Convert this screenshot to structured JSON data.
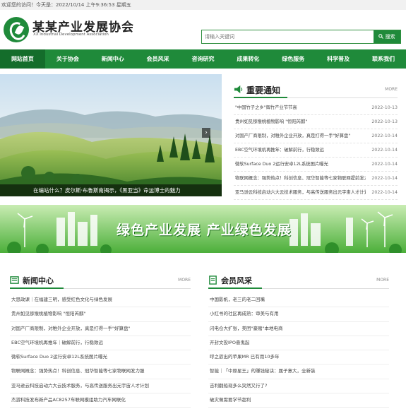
{
  "topbar": {
    "welcome": "欢迎您的访问！今天是：2022/10/14 上午9:36:53 星期五"
  },
  "header": {
    "title": "某某产业发展协会",
    "subtitle": "XX Industrial Development Association"
  },
  "search": {
    "placeholder": "请输入关键词",
    "button": "搜索",
    "button_icon": "search-icon"
  },
  "nav": [
    "网站首页",
    "关于协会",
    "新闻中心",
    "会员风采",
    "咨询研究",
    "成果转化",
    "绿色服务",
    "科学普及",
    "联系我们"
  ],
  "slider": {
    "caption": "在编站什么？皮尔斯·布鲁斯南揭示，《黑亚当》命运博士的魅力"
  },
  "notice": {
    "title": "重要通知",
    "more": "MORE",
    "items": [
      {
        "t": "\"中国竹子之乡\"辉竹产业节节高",
        "d": "2022-10-13"
      },
      {
        "t": "贵州如见猕猴桃植物影响 \"恒阳芮麒\"",
        "d": "2022-10-13"
      },
      {
        "t": "对国产厂商限制，对稚外企业开放，真是打得一手\"好算盘\"",
        "d": "2022-10-14"
      },
      {
        "t": "EBC空气环境机再推年：破解前行，行稳致远",
        "d": "2022-10-14"
      },
      {
        "t": "微软Surface Duo 2运行安卓12L系统图片曝光",
        "d": "2022-10-14"
      },
      {
        "t": "物联网概念：强势热点！科创信息、冠华智能等七家物联网提前发力",
        "d": "2022-10-14"
      },
      {
        "t": "亚马逊云科技启动六大云技术服务，与高传送服务出元宇宙人才计划",
        "d": "2022-10-14"
      }
    ]
  },
  "banner": {
    "text": "绿色产业发展 产业绿色发展"
  },
  "news": {
    "title": "新闻中心",
    "more": "MORE",
    "items": [
      "大思政课｜在福建三明，感受红色文化与绿色发展",
      "贵州如见猕猴桃植物影响 \"恒阳芮麒\"",
      "对国产厂商限制，对稚外企业开放，真是打得一手\"好算盘\"",
      "EBC空气环境机再推年｜破解前行，行稳致远",
      "微软Surface Duo 2运行安卓12L系统图片曝光",
      "物联网概念：强势热点！科创信息、冠华智能等七家物联网发力服",
      "亚马逊云科技启动六大云技术服务，与高传送服务出元宇宙人才计划",
      "杰游科技发布新产品AC8257车联网模组助力汽车网联化"
    ]
  },
  "members": {
    "title": "会员风采",
    "more": "MORE",
    "items": [
      "中国影帆，老三的老二回嘴",
      "小红书的社区再成熟：审美与有用",
      "闪电仓大扩张，美团\"豪赌\"本地电商",
      "开封文投IPO悬鬼起",
      "呼之欲出的苹果MR 已有用10多年",
      "智能｜「中原星王」的赚钱秘诀：属子意大，全新装",
      "吉利翻船现多么突然又行了?",
      "破灾做需要学节超利"
    ]
  },
  "colors": {
    "brand_green": "#1f8a3a",
    "nav_active": "#146d2b"
  }
}
